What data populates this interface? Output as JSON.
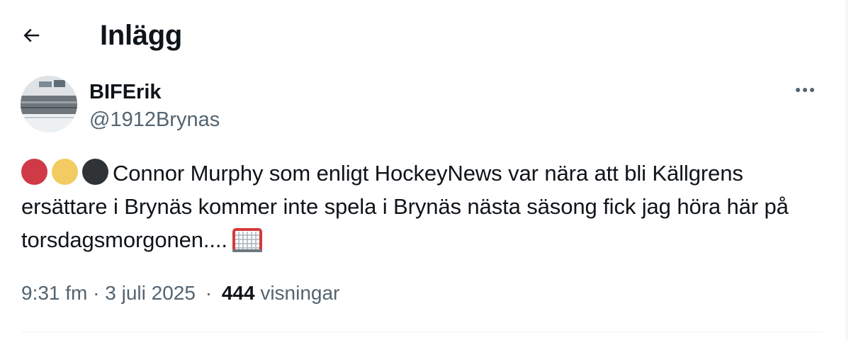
{
  "header": {
    "title": "Inlägg"
  },
  "post": {
    "author": {
      "display_name": "BIFErik",
      "handle": "@1912Brynas"
    },
    "status_dots": [
      "#cf3a46",
      "#f2cc62",
      "#2f3336"
    ],
    "text": "Connor Murphy som enligt HockeyNews var nära att bli Källgrens ersättare i Brynäs kommer inte spela i Brynäs nästa säsong fick jag höra här på torsdagsmorgonen....",
    "timestamp": "9:31 fm · 3 juli 2025",
    "separator": "·",
    "views_count": "444",
    "views_label": "visningar"
  },
  "icons": {
    "back": "arrow-left-icon",
    "more": "more-horizontal-icon",
    "goal": "goal-net-icon"
  },
  "colors": {
    "text_primary": "#0f1419",
    "text_secondary": "#536471",
    "border": "#eff3f4"
  }
}
